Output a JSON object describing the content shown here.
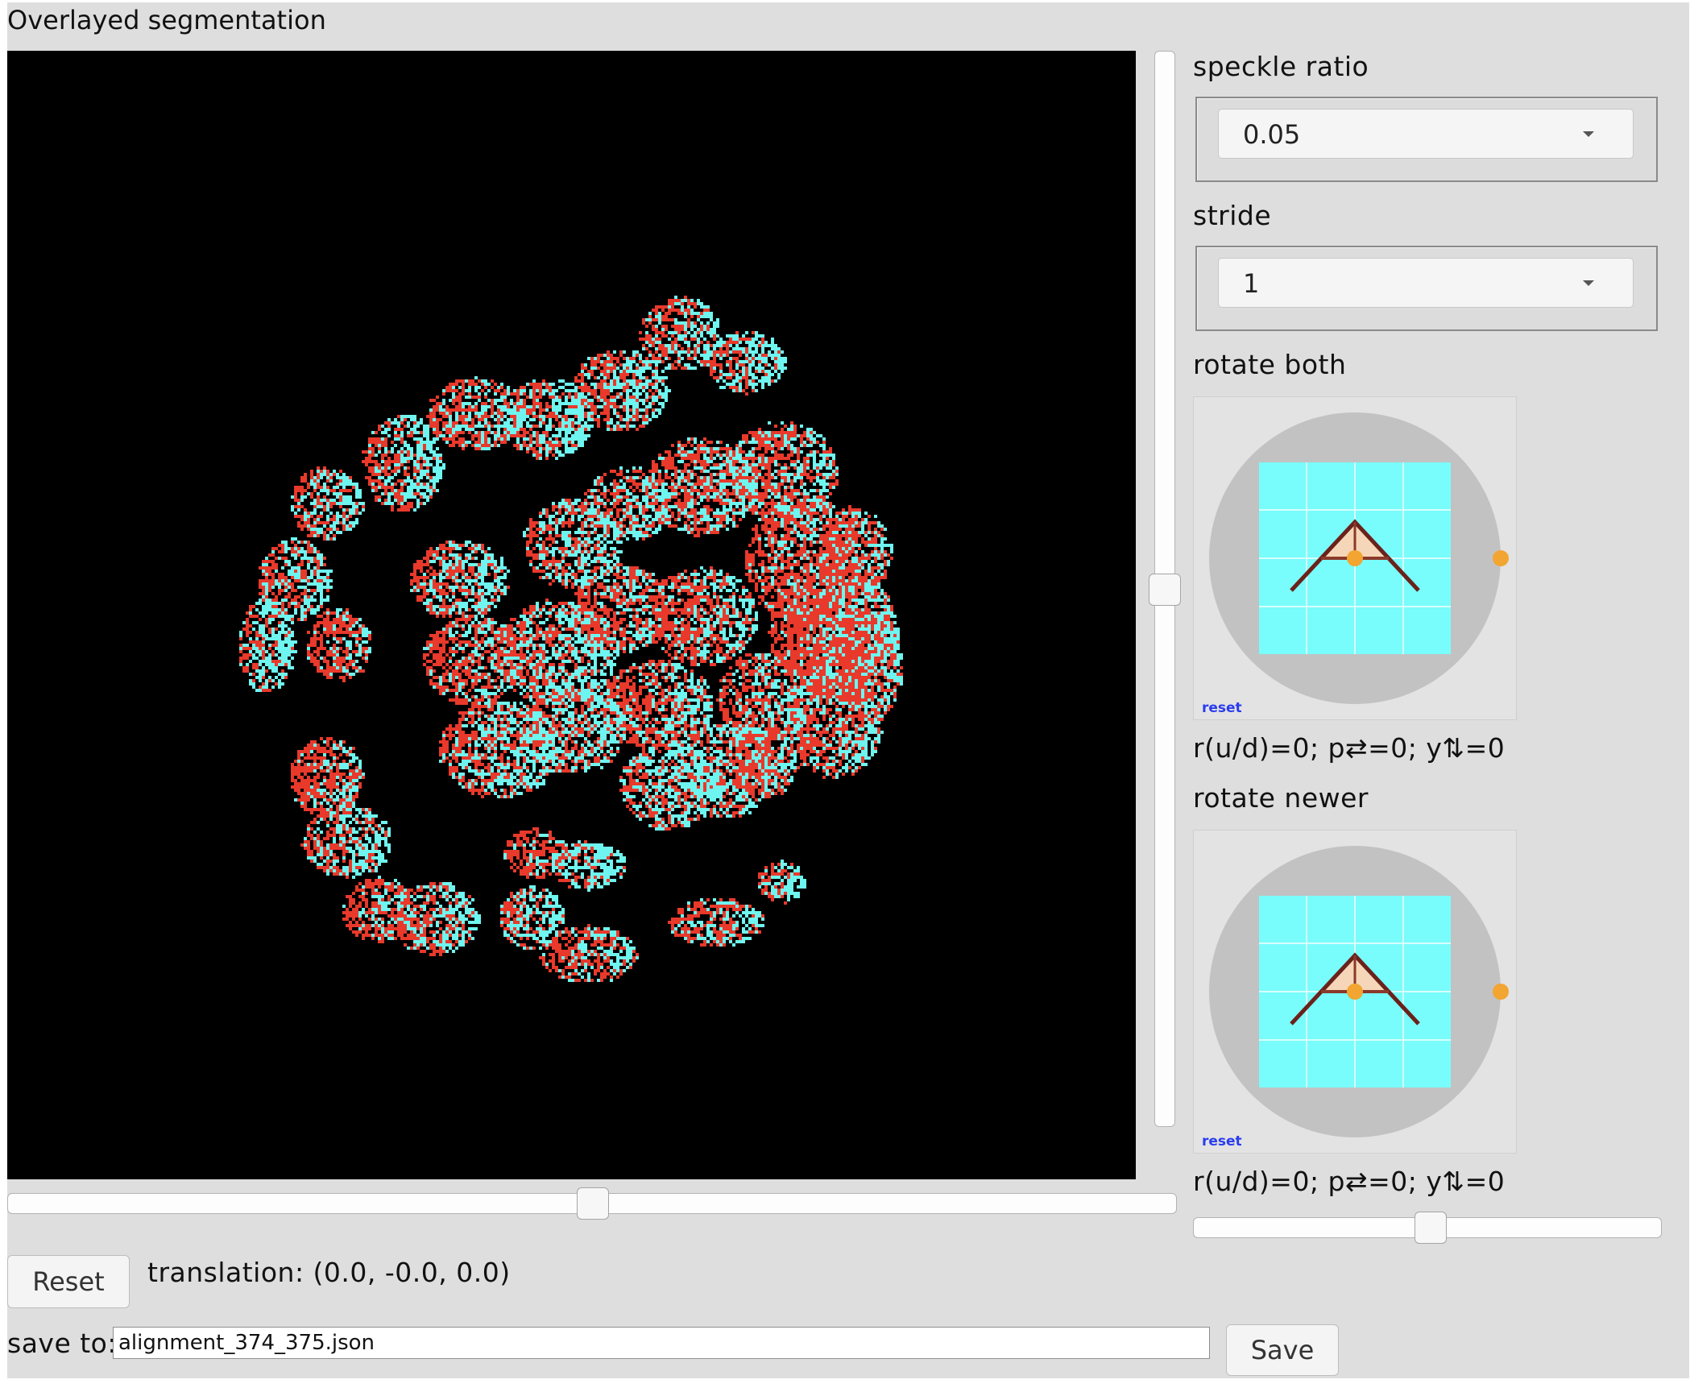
{
  "panel": {
    "title": "Overlayed segmentation"
  },
  "controls": {
    "speckle_ratio": {
      "label": "speckle ratio",
      "value": "0.05"
    },
    "stride": {
      "label": "stride",
      "value": "1"
    },
    "rotate_both": {
      "label": "rotate both",
      "reset": "reset",
      "readout": "r(u/d)=0; p⇄=0; y⇅=0"
    },
    "rotate_newer": {
      "label": "rotate newer",
      "reset": "reset",
      "readout": "r(u/d)=0; p⇄=0; y⇅=0"
    },
    "horizontal_slider_value": 0.5,
    "vertical_slider_value": 0.5,
    "right_slider_value": 0.5
  },
  "footer": {
    "reset_label": "Reset",
    "translation_text": "translation: (0.0, -0.0, 0.0)",
    "save_to_label": "save to:",
    "save_path": "alignment_374_375.json",
    "save_label": "Save"
  },
  "colors": {
    "background": "#000000",
    "segmentation_a": "#e8392b",
    "segmentation_b": "#6ff5ef",
    "panel": "#dedede",
    "widget_fill": "#79fcfc",
    "handle": "#f2a531"
  },
  "icons": [
    "rotation-widget-icon",
    "caret-down-icon"
  ]
}
